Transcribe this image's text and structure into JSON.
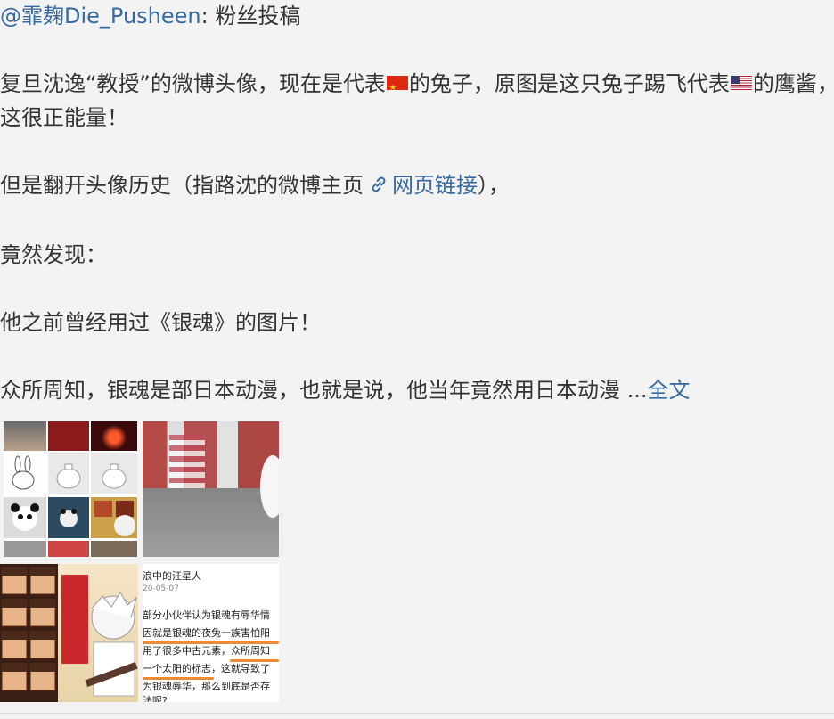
{
  "post": {
    "author_handle": "@霏麹Die_Pusheen",
    "author_suffix": ": 粉丝投稿",
    "p1_a": "复旦沈逸“教授”的微博头像，现在是代表",
    "p1_b": "的兔子，原图是这只兔子踢飞代表",
    "p1_c": "的鹰酱，",
    "p1_d": "这很正能量！",
    "p2_a": "但是翻开头像历史（指路沈的微博主页",
    "p2_link": "网页链接",
    "p2_b": "），",
    "p3": "竟然发现：",
    "p4": "他之前曾经用过《银魂》的图片！",
    "p5": "众所周知，银魂是部日本动漫，也就是说，他当年竟然用日本动漫 ...",
    "p5_more": "全文"
  },
  "icons": {
    "flag_cn": "china-flag-icon",
    "flag_us": "usa-flag-icon",
    "link": "link-chain-icon"
  },
  "thumb4": {
    "header": "浪中的汪星人",
    "date": "20-05-07",
    "line1": "部分小伙伴认为银魂有辱华情",
    "line2": "因就是银魂的夜兔一族害怕阳",
    "line3": "用了很多中古元素，众所周知",
    "line4": "一个太阳的标志，这就导致了",
    "line5": "为银魂辱华，那么到底是否存",
    "line6": "法呢?"
  },
  "colors": {
    "link": "#376aa0",
    "text": "#333333",
    "background": "#f3f3f3",
    "underline": "#f08a30"
  }
}
